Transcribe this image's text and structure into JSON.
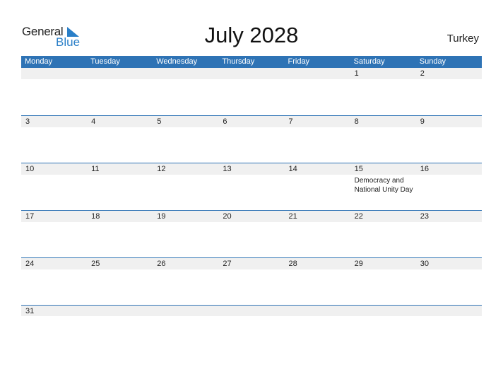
{
  "logo": {
    "general": "General",
    "blue": "Blue"
  },
  "title": "July 2028",
  "country": "Turkey",
  "colors": {
    "header": "#2e73b5",
    "band": "#f0f0f0",
    "logo_blue": "#2a7fc8"
  },
  "weekdays": [
    "Monday",
    "Tuesday",
    "Wednesday",
    "Thursday",
    "Friday",
    "Saturday",
    "Sunday"
  ],
  "weeks": [
    [
      {
        "d": ""
      },
      {
        "d": ""
      },
      {
        "d": ""
      },
      {
        "d": ""
      },
      {
        "d": ""
      },
      {
        "d": "1"
      },
      {
        "d": "2"
      }
    ],
    [
      {
        "d": "3"
      },
      {
        "d": "4"
      },
      {
        "d": "5"
      },
      {
        "d": "6"
      },
      {
        "d": "7"
      },
      {
        "d": "8"
      },
      {
        "d": "9"
      }
    ],
    [
      {
        "d": "10"
      },
      {
        "d": "11"
      },
      {
        "d": "12"
      },
      {
        "d": "13"
      },
      {
        "d": "14"
      },
      {
        "d": "15",
        "holiday": "Democracy and National Unity Day"
      },
      {
        "d": "16"
      }
    ],
    [
      {
        "d": "17"
      },
      {
        "d": "18"
      },
      {
        "d": "19"
      },
      {
        "d": "20"
      },
      {
        "d": "21"
      },
      {
        "d": "22"
      },
      {
        "d": "23"
      }
    ],
    [
      {
        "d": "24"
      },
      {
        "d": "25"
      },
      {
        "d": "26"
      },
      {
        "d": "27"
      },
      {
        "d": "28"
      },
      {
        "d": "29"
      },
      {
        "d": "30"
      }
    ],
    [
      {
        "d": "31"
      },
      {
        "d": ""
      },
      {
        "d": ""
      },
      {
        "d": ""
      },
      {
        "d": ""
      },
      {
        "d": ""
      },
      {
        "d": ""
      }
    ]
  ]
}
